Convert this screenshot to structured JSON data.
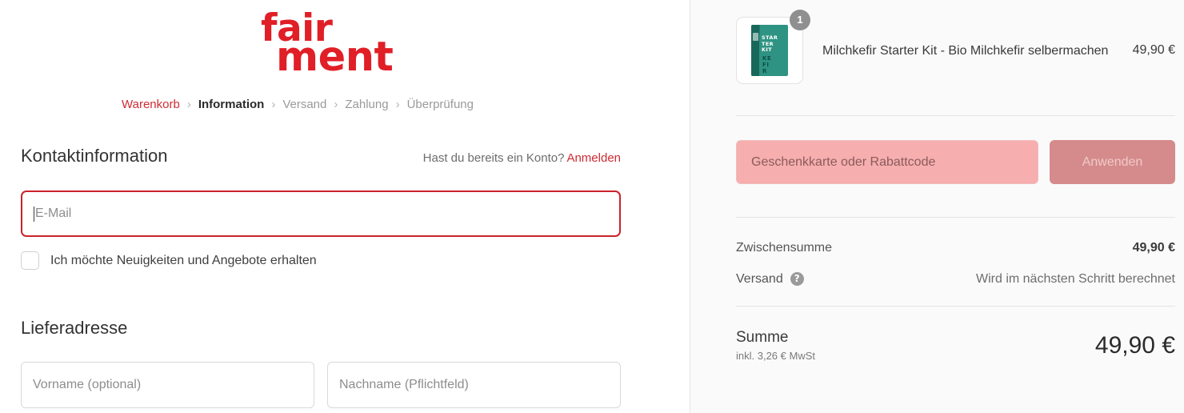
{
  "brand": {
    "logo_line1": "fair",
    "logo_line2": "ment",
    "logo_color": "#e01f26"
  },
  "breadcrumb": {
    "separator": "›",
    "items": [
      {
        "label": "Warenkorb",
        "state": "link"
      },
      {
        "label": "Information",
        "state": "active"
      },
      {
        "label": "Versand",
        "state": "muted"
      },
      {
        "label": "Zahlung",
        "state": "muted"
      },
      {
        "label": "Überprüfung",
        "state": "muted"
      }
    ]
  },
  "contact": {
    "title": "Kontaktinformation",
    "account_question": "Hast du bereits ein Konto?",
    "login_link": "Anmelden",
    "email_placeholder": "E-Mail",
    "email_value": "",
    "newsletter_label": "Ich möchte Neuigkeiten und Angebote erhalten",
    "newsletter_checked": false
  },
  "shipping_address": {
    "title": "Lieferadresse",
    "first_name_placeholder": "Vorname (optional)",
    "first_name_value": "",
    "last_name_placeholder": "Nachname (Pflichtfeld)",
    "last_name_value": ""
  },
  "summary": {
    "line_item": {
      "quantity_badge": "1",
      "title": "Milchkefir Starter Kit - Bio Milchkefir selbermachen",
      "price": "49,90 €",
      "thumb_text": {
        "l1": "STAR",
        "l2": "TER",
        "l3": "KIT",
        "k1": "KE",
        "k2": "FI",
        "k3": "R"
      }
    },
    "discount": {
      "placeholder": "Geschenkkarte oder Rabattcode",
      "value": "",
      "apply_label": "Anwenden",
      "apply_disabled": true
    },
    "subtotal_label": "Zwischensumme",
    "subtotal_value": "49,90 €",
    "shipping_label": "Versand",
    "shipping_help_icon": "?",
    "shipping_value": "Wird im nächsten Schritt berechnet",
    "total_label": "Summe",
    "total_tax_note": "inkl. 3,26 € MwSt",
    "total_value": "49,90 €"
  },
  "colors": {
    "brand_red": "#e01f26",
    "link_red": "#d02b33",
    "focus_red": "#c9232a",
    "sidebar_bg": "#fafafa",
    "discount_highlight": "#f7aeae",
    "apply_button": "#d58b8b",
    "product_teal": "#2e9382"
  }
}
